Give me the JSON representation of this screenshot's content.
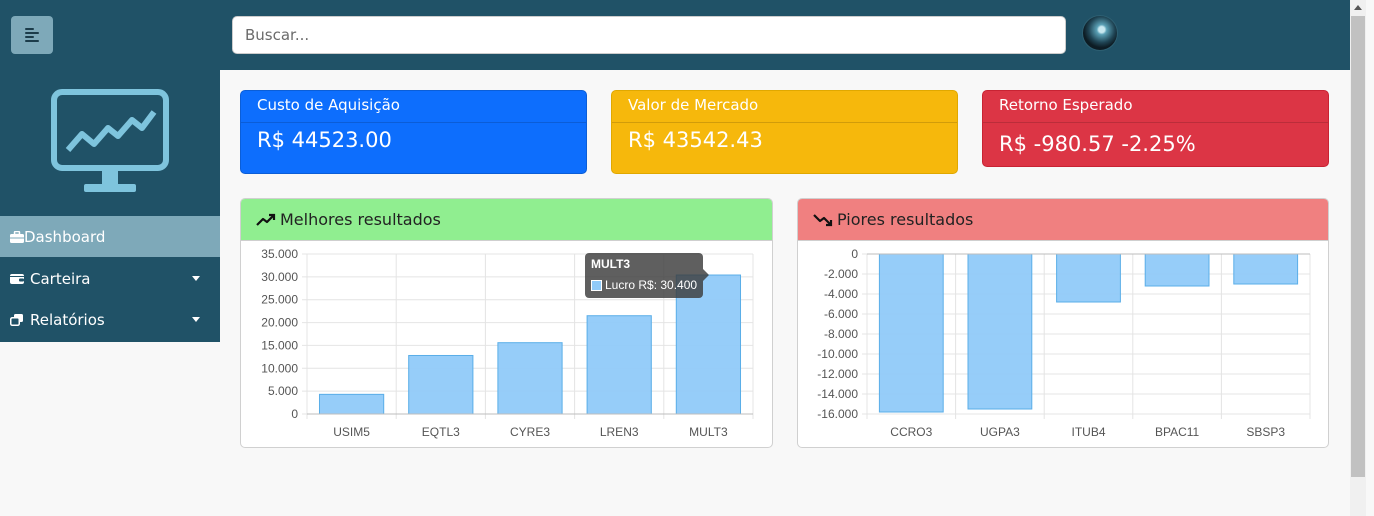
{
  "search": {
    "placeholder": "Buscar..."
  },
  "sidebar": {
    "logo_icon": "monitor-chart-icon",
    "items": [
      {
        "label": "Dashboard",
        "icon": "briefcase-icon",
        "active": true
      },
      {
        "label": "Carteira",
        "icon": "wallet-icon",
        "has_submenu": true
      },
      {
        "label": "Relatórios",
        "icon": "copy-icon",
        "has_submenu": true
      }
    ]
  },
  "cards": [
    {
      "title": "Custo de Aquisição",
      "value": "R$ 44523.00",
      "color": "#0d6efd"
    },
    {
      "title": "Valor de Mercado",
      "value": "R$ 43542.43",
      "color": "#f6b80c"
    },
    {
      "title": "Retorno Esperado",
      "value": "R$ -980.57 -2.25%",
      "color": "#dc3545"
    }
  ],
  "panels": {
    "best": {
      "title": "Melhores resultados",
      "icon": "trend-up-icon",
      "color": "#90ee90"
    },
    "worst": {
      "title": "Piores resultados",
      "icon": "trend-down-icon",
      "color": "#f08080"
    }
  },
  "tooltip": {
    "title": "MULT3",
    "label": "Lucro R$: 30.400"
  },
  "chart_data": [
    {
      "type": "bar",
      "categories": [
        "USIM5",
        "EQTL3",
        "CYRE3",
        "LREN3",
        "MULT3"
      ],
      "series": [
        {
          "name": "Lucro R$",
          "values": [
            4300,
            12800,
            15600,
            21500,
            30400
          ]
        }
      ],
      "ylim": [
        0,
        35000
      ],
      "yticks": [
        0,
        5000,
        10000,
        15000,
        20000,
        25000,
        30000,
        35000
      ],
      "ytick_labels": [
        "0",
        "5.000",
        "10.000",
        "15.000",
        "20.000",
        "25.000",
        "30.000",
        "35.000"
      ],
      "bar_color": "#90caf9",
      "grid": true
    },
    {
      "type": "bar",
      "categories": [
        "CCRO3",
        "UGPA3",
        "ITUB4",
        "BPAC11",
        "SBSP3"
      ],
      "series": [
        {
          "name": "Lucro R$",
          "values": [
            -15800,
            -15500,
            -4800,
            -3200,
            -3000
          ]
        }
      ],
      "ylim": [
        -16000,
        0
      ],
      "yticks": [
        0,
        -2000,
        -4000,
        -6000,
        -8000,
        -10000,
        -12000,
        -14000,
        -16000
      ],
      "ytick_labels": [
        "0",
        "-2.000",
        "-4.000",
        "-6.000",
        "-8.000",
        "-10.000",
        "-12.000",
        "-14.000",
        "-16.000"
      ],
      "bar_color": "#90caf9",
      "grid": true
    }
  ]
}
